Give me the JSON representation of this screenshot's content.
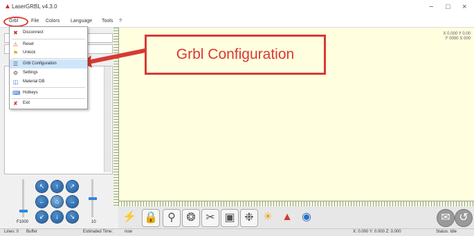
{
  "window": {
    "title": "LaserGRBL v4.3.0",
    "minimize_glyph": "−",
    "maximize_glyph": "□",
    "close_glyph": "×"
  },
  "menu": {
    "items": [
      "Grbl",
      "File",
      "Colors",
      "Language",
      "Tools",
      "?"
    ]
  },
  "grbl_menu": {
    "items": [
      {
        "label": "Disconnect",
        "icon": "disconnect-icon"
      },
      {
        "label": "Reset",
        "icon": "reset-icon"
      },
      {
        "label": "Unlock",
        "icon": "unlock-icon"
      },
      {
        "label": "Grbl Configuration",
        "icon": "grbl-configuration-icon"
      },
      {
        "label": "Settings",
        "icon": "settings-icon"
      },
      {
        "label": "Material DB",
        "icon": "material-db-icon"
      },
      {
        "label": "Hotkeys",
        "icon": "hotkeys-icon"
      },
      {
        "label": "Exit",
        "icon": "exit-icon"
      }
    ]
  },
  "callout": {
    "text": "Grbl Configuration",
    "color": "#d73a33"
  },
  "canvas": {
    "coord_line1": "X 0.000 Y 0.00",
    "coord_line2": "F 0000 S 000"
  },
  "jog": {
    "speed_label": "F1000",
    "step_label": "10"
  },
  "status": {
    "lines_label": "Lines: 0",
    "buffer_label": "Buffer",
    "time_label": "Estimated Time:",
    "time_value": "now",
    "position": "X: 0.000 Y: 0.000 Z: 0.000",
    "state": "Status: Idle"
  },
  "colors": {
    "canvas": "#fffedf",
    "accent_red": "#d73a33",
    "jog_blue": "#2e6fb3"
  }
}
